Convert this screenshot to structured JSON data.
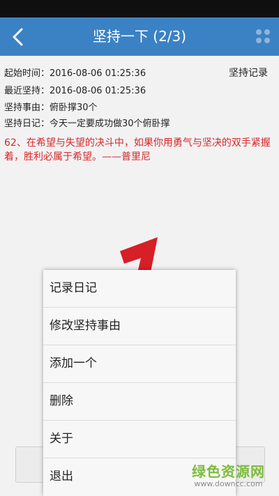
{
  "appbar": {
    "title": "坚持一下 (2/3)",
    "back_icon": "chevron-left-icon",
    "more_icon": "grid-dots-icon",
    "color": "#3b82c4"
  },
  "record": {
    "start_label": "起始时间：",
    "start_value": "2016-08-06 01:25:36",
    "recent_label": "最近坚持：",
    "recent_value": "2016-08-06 01:25:36",
    "reason_label": "坚持事由：",
    "reason_value": "俯卧撑30个",
    "diary_label": "坚持日记：",
    "diary_value": "今天一定要成功做30个俯卧撑",
    "history_link": "坚持记录"
  },
  "quote": "62、在希望与失望的决斗中，如果你用勇气与坚决的双手紧握着，胜利必属于希望。——普里尼",
  "menu": {
    "items": [
      {
        "label": "记录日记"
      },
      {
        "label": "修改坚持事由"
      },
      {
        "label": "添加一个"
      },
      {
        "label": "删除"
      },
      {
        "label": "关于"
      },
      {
        "label": "退出"
      }
    ]
  },
  "watermark": {
    "title": "绿色资源网",
    "url": "www.downcc.com"
  },
  "colors": {
    "quote": "#d9262a",
    "watermark": "#7dbb3c"
  }
}
